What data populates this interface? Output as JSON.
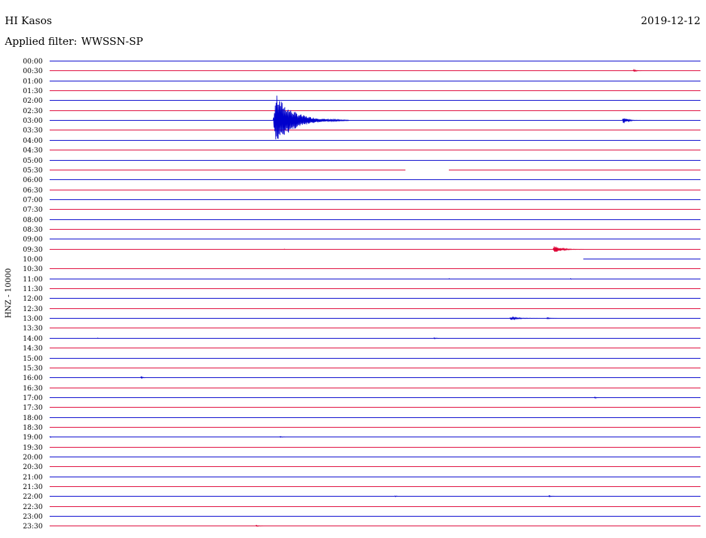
{
  "header": {
    "station": "HI Kasos",
    "date": "2019-12-12",
    "filter_label": "Applied filter:",
    "filter_value": "WWSSN-SP"
  },
  "chart_data": {
    "type": "line",
    "ylabel": "HNZ - 10000",
    "colors": [
      "#0000cc",
      "#dd0033"
    ],
    "rows": [
      "00:00",
      "00:30",
      "01:00",
      "01:30",
      "02:00",
      "02:30",
      "03:00",
      "03:30",
      "04:00",
      "04:30",
      "05:00",
      "05:30",
      "06:00",
      "06:30",
      "07:00",
      "07:30",
      "08:00",
      "08:30",
      "09:00",
      "09:30",
      "10:00",
      "10:30",
      "11:00",
      "11:30",
      "12:00",
      "12:30",
      "13:00",
      "13:30",
      "14:00",
      "14:30",
      "15:00",
      "15:30",
      "16:00",
      "16:30",
      "17:00",
      "17:30",
      "18:00",
      "18:30",
      "19:00",
      "19:30",
      "20:00",
      "20:30",
      "21:00",
      "21:30",
      "22:00",
      "22:30",
      "23:00",
      "23:30"
    ],
    "time_axis_minutes": [
      0,
      30
    ],
    "gaps": [
      {
        "row": "05:30",
        "start_min": 16.4,
        "end_min": 18.4
      },
      {
        "row": "10:00",
        "start_min": 0,
        "end_min": 24.6
      }
    ],
    "events": [
      {
        "row": "00:30",
        "time_min": 26.9,
        "duration_min": 0.5,
        "amplitude": 2
      },
      {
        "row": "03:00",
        "time_min": 10.3,
        "duration_min": 3.5,
        "amplitude": 38
      },
      {
        "row": "03:00",
        "time_min": 26.4,
        "duration_min": 0.9,
        "amplitude": 5
      },
      {
        "row": "09:30",
        "time_min": 23.2,
        "duration_min": 1.5,
        "amplitude": 5
      },
      {
        "row": "09:30",
        "time_min": 10.8,
        "duration_min": 0.1,
        "amplitude": 1
      },
      {
        "row": "11:00",
        "time_min": 18.4,
        "duration_min": 0.1,
        "amplitude": 1
      },
      {
        "row": "11:00",
        "time_min": 24.0,
        "duration_min": 0.1,
        "amplitude": 1
      },
      {
        "row": "13:00",
        "time_min": 21.2,
        "duration_min": 1.8,
        "amplitude": 2
      },
      {
        "row": "13:00",
        "time_min": 22.9,
        "duration_min": 0.8,
        "amplitude": 1
      },
      {
        "row": "14:00",
        "time_min": 17.7,
        "duration_min": 0.5,
        "amplitude": 1
      },
      {
        "row": "14:00",
        "time_min": 2.2,
        "duration_min": 0.1,
        "amplitude": 1
      },
      {
        "row": "16:00",
        "time_min": 4.2,
        "duration_min": 0.3,
        "amplitude": 2
      },
      {
        "row": "17:00",
        "time_min": 25.1,
        "duration_min": 0.4,
        "amplitude": 1
      },
      {
        "row": "19:00",
        "time_min": 10.6,
        "duration_min": 0.4,
        "amplitude": 1
      },
      {
        "row": "19:00",
        "time_min": 0.0,
        "duration_min": 0.2,
        "amplitude": 1
      },
      {
        "row": "22:00",
        "time_min": 23.0,
        "duration_min": 0.4,
        "amplitude": 1
      },
      {
        "row": "22:00",
        "time_min": 15.9,
        "duration_min": 0.3,
        "amplitude": 1
      },
      {
        "row": "23:30",
        "time_min": 9.5,
        "duration_min": 0.5,
        "amplitude": 1
      }
    ]
  }
}
